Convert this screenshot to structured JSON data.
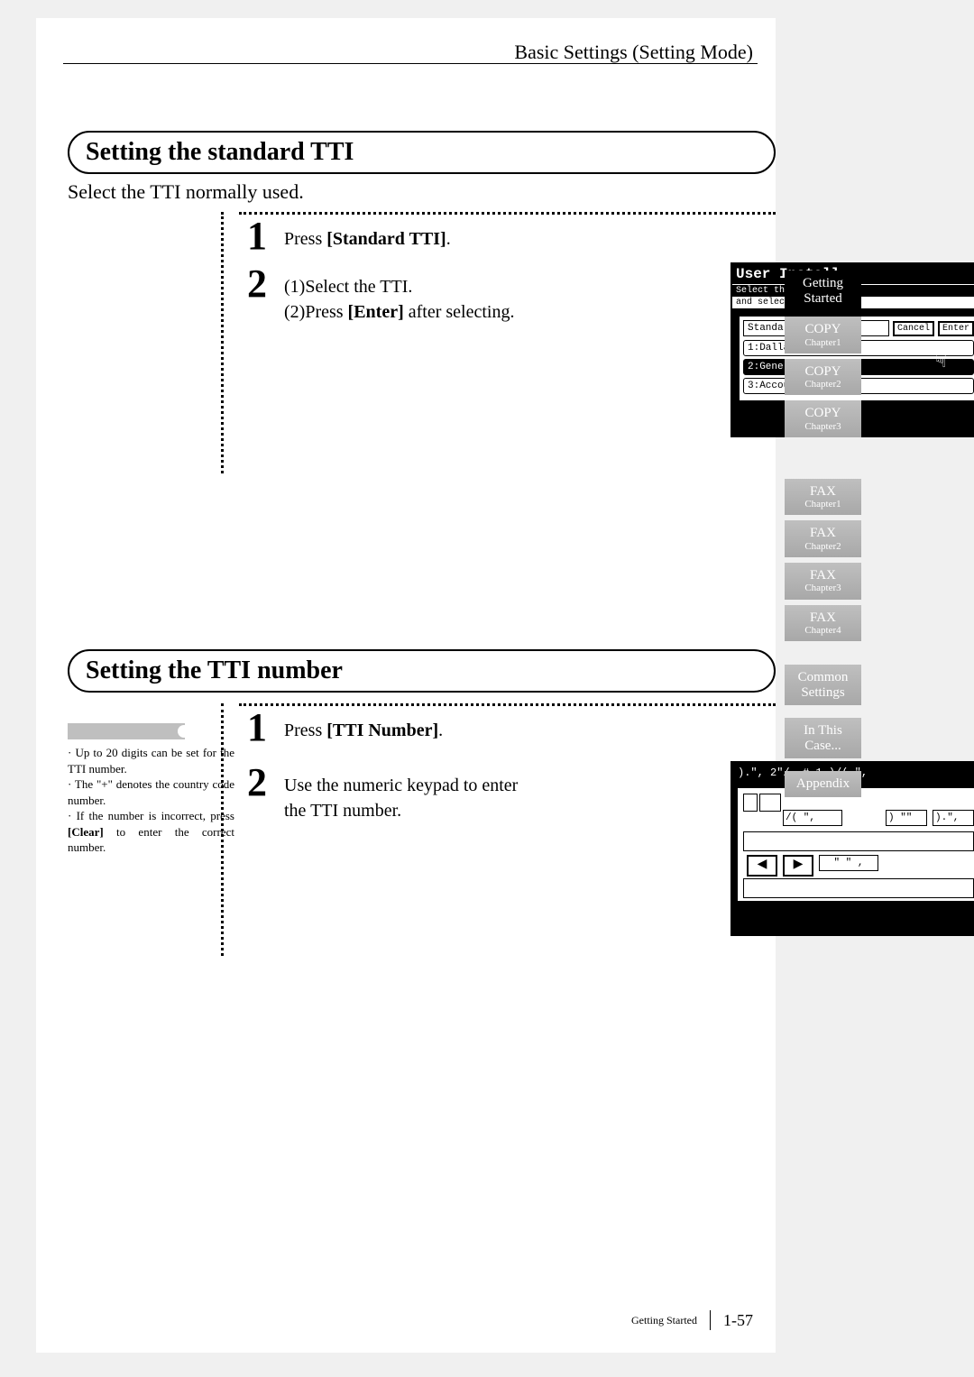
{
  "header": {
    "title": "Basic Settings (Setting Mode)"
  },
  "section1": {
    "heading": "Setting the standard TTI",
    "intro": "Select the TTI normally used.",
    "steps": [
      {
        "num": "1",
        "pre": "Press ",
        "bold": "[Standard TTI]",
        "post": "."
      },
      {
        "num": "2",
        "line1_pre": "(1)Select the TTI.",
        "line2_pre": "(2)Press ",
        "line2_bold": "[Enter]",
        "line2_post": " after selecting."
      }
    ],
    "screen": {
      "title": "User Install",
      "sub1": "Select the Default TTI",
      "sub2": "and select [Enter].",
      "field": "Standard TTI",
      "btn_cancel": "Cancel",
      "btn_enter": "Enter",
      "rows": [
        "1:Dallas Office",
        "2:General dep.",
        "3:Account dep."
      ]
    }
  },
  "section2": {
    "heading": "Setting the TTI number",
    "notes": [
      "Up to 20 digits can be set for the TTI number.",
      "The \"+\" denotes the country code number.",
      "If the number is incorrect, press [Clear] to enter the correct number."
    ],
    "note_bold": "[Clear]",
    "steps": [
      {
        "num": "1",
        "pre": "Press ",
        "bold": "[TTI Number]",
        "post": "."
      },
      {
        "num": "2",
        "text": "Use the numeric keypad to enter the TTI number."
      }
    ],
    "screen": {
      "title_line": ").\", 2\"/, # 1 )/( \",",
      "row_text": "/( \",",
      "btn1": ") \"\"",
      "btn2": ").\",",
      "lower": "\" \" ,"
    }
  },
  "tabs": [
    {
      "label": "Getting Started",
      "active": true
    },
    {
      "label": "COPY",
      "sub": "Chapter1"
    },
    {
      "label": "COPY",
      "sub": "Chapter2"
    },
    {
      "label": "COPY",
      "sub": "Chapter3"
    },
    {
      "label": "FAX",
      "sub": "Chapter1"
    },
    {
      "label": "FAX",
      "sub": "Chapter2"
    },
    {
      "label": "FAX",
      "sub": "Chapter3"
    },
    {
      "label": "FAX",
      "sub": "Chapter4"
    },
    {
      "label": "Common Settings"
    },
    {
      "label": "In This Case..."
    },
    {
      "label": "Appendix"
    }
  ],
  "footer": {
    "section": "Getting Started",
    "page": "1-57"
  }
}
